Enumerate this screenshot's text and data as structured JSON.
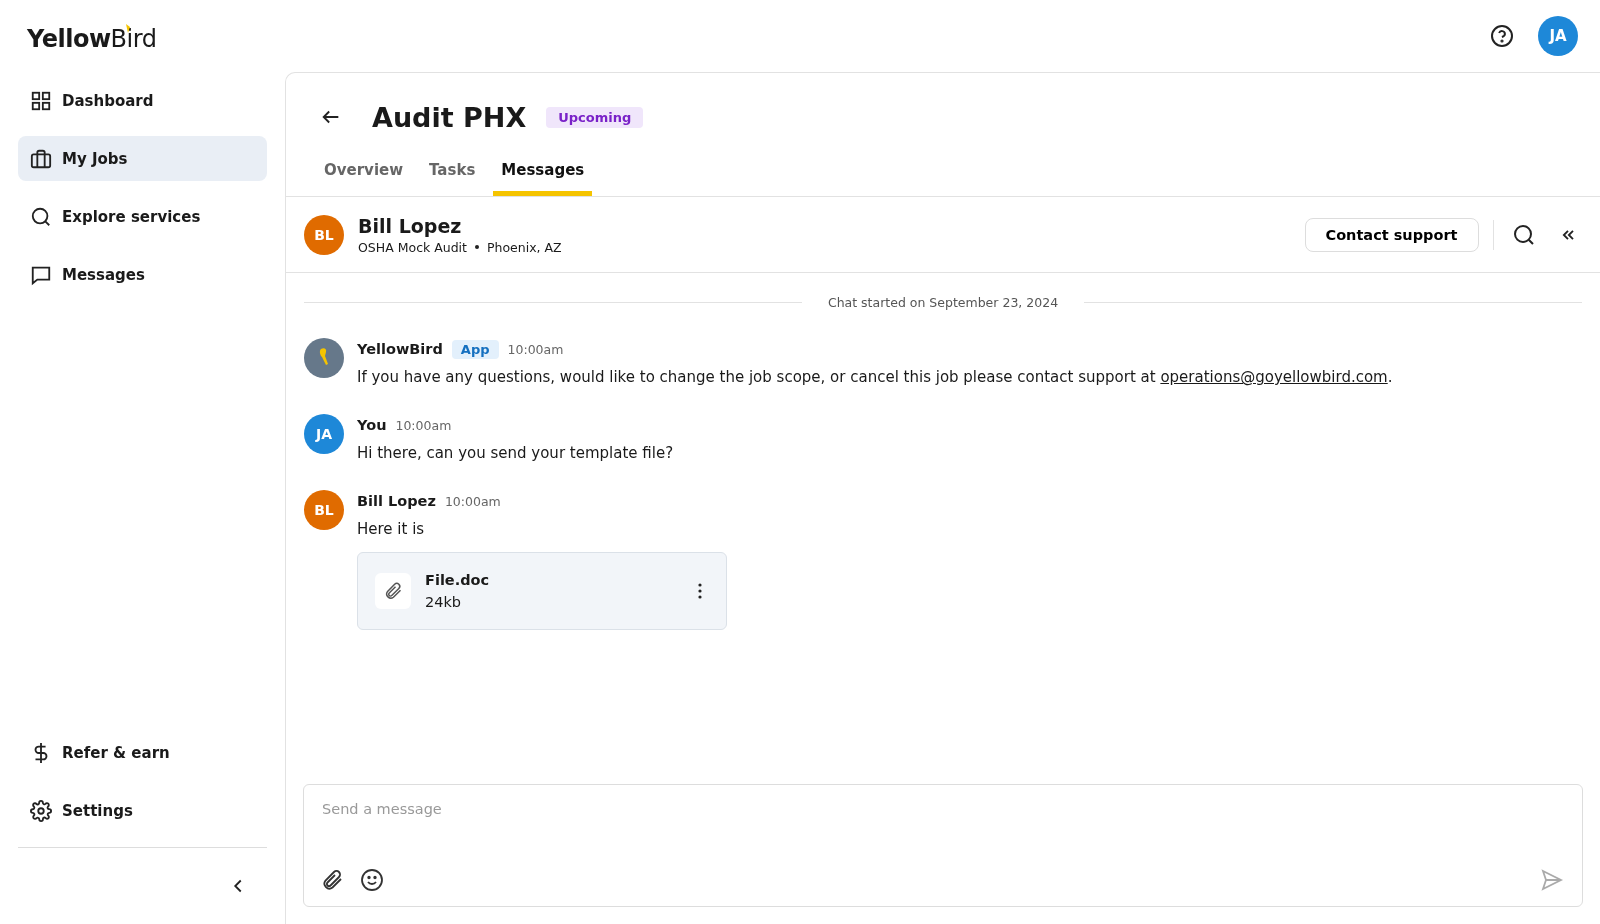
{
  "logo": "**Yellow**Bird",
  "header": {
    "avatar_initials": "JA"
  },
  "sidebar": {
    "items": [
      {
        "label": "Dashboard",
        "selected": false
      },
      {
        "label": "My Jobs",
        "selected": true
      },
      {
        "label": "Explore services",
        "selected": false
      },
      {
        "label": "Messages",
        "selected": false
      }
    ],
    "bottom_items": [
      {
        "label": "Refer & earn",
        "selected": false
      },
      {
        "label": "Settings",
        "selected": false
      }
    ]
  },
  "job": {
    "title": "Audit PHX",
    "status": "Upcoming"
  },
  "tabs": [
    {
      "label": "Overview",
      "selected": false
    },
    {
      "label": "Tasks",
      "selected": false
    },
    {
      "label": "Messages",
      "selected": true
    }
  ],
  "contact": {
    "initials": "BL",
    "color": "#e06b00",
    "name": "Bill Lopez",
    "service": "OSHA Mock Audit",
    "location": "Phoenix, AZ",
    "support_button": "Contact support"
  },
  "chat_start": "Chat started on September 23, 2024",
  "messages": [
    {
      "kind": "app",
      "sender": "YellowBird",
      "badge": "App",
      "time": "10:00am",
      "color": "#66788a",
      "text": "If you have any questions,  would like to change the job scope, or cancel this job please contact support at ",
      "link": "operations@goyellowbird.com",
      "text_after": "."
    },
    {
      "kind": "user",
      "initials": "JA",
      "sender": "You",
      "time": "10:00am",
      "color": "#1e88d8",
      "text": "Hi there, can you send your template file?"
    },
    {
      "kind": "user",
      "initials": "BL",
      "sender": "Bill Lopez",
      "time": "10:00am",
      "color": "#e06b00",
      "text": "Here it is",
      "attachment": {
        "name": "File.doc",
        "size": "24kb"
      }
    }
  ],
  "composer": {
    "placeholder": "Send a message"
  }
}
